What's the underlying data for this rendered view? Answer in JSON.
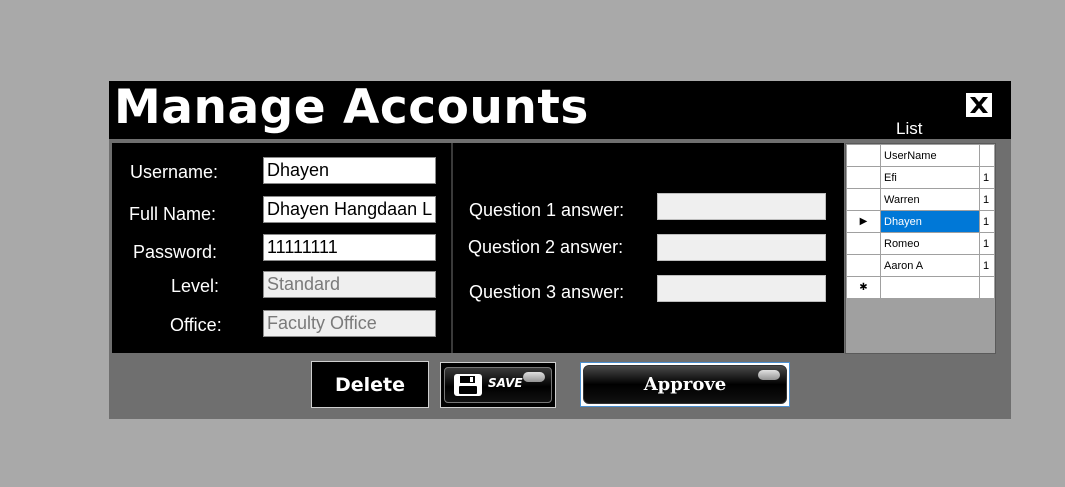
{
  "window": {
    "title": "Manage Accounts",
    "list_label": "List"
  },
  "form": {
    "username_label": "Username:",
    "username_value": "Dhayen",
    "fullname_label": "Full Name:",
    "fullname_value": "Dhayen Hangdaan L",
    "password_label": "Password:",
    "password_value": "11111111",
    "level_label": "Level:",
    "level_value": "Standard",
    "office_label": "Office:",
    "office_value": "Faculty Office"
  },
  "questions": {
    "q1_label": "Question 1 answer:",
    "q1_value": "",
    "q2_label": "Question 2 answer:",
    "q2_value": "",
    "q3_label": "Question 3 answer:",
    "q3_value": ""
  },
  "grid": {
    "column_header": "UserName",
    "rows": [
      {
        "username": "Efi",
        "col2": "1"
      },
      {
        "username": "Warren",
        "col2": "1"
      },
      {
        "username": "Dhayen",
        "col2": "1",
        "selected": true
      },
      {
        "username": "Romeo",
        "col2": "1"
      },
      {
        "username": "Aaron A",
        "col2": "1"
      }
    ],
    "current_row_marker": "▶",
    "new_row_marker": "✱"
  },
  "buttons": {
    "delete_label": "Delete",
    "save_label": "SAVE",
    "approve_label": "Approve"
  },
  "colors": {
    "selection": "#0078d7",
    "panel": "#000000",
    "window_bg": "#6f6f6f",
    "desktop_bg": "#a9a9a9"
  }
}
